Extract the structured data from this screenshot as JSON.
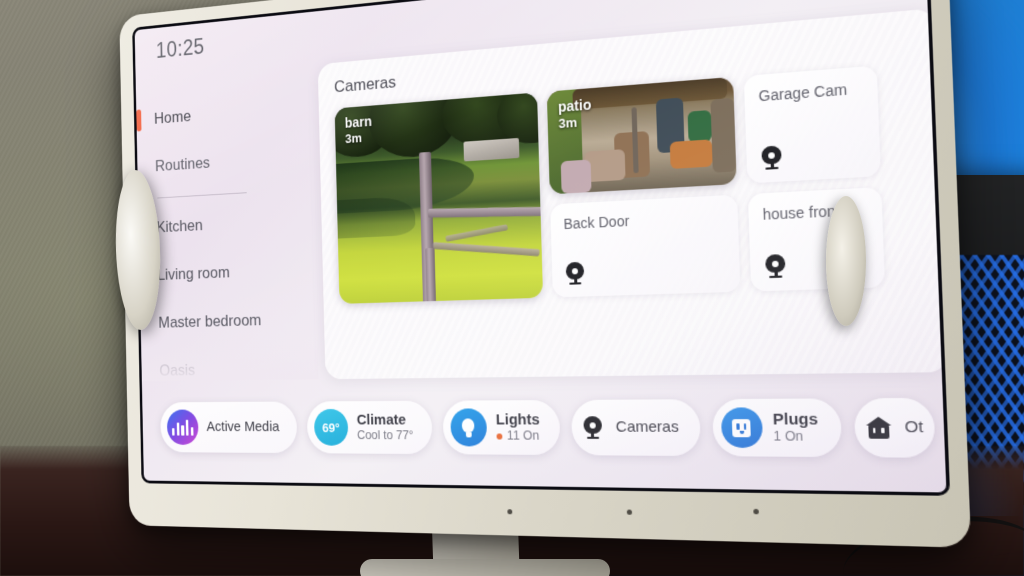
{
  "device": {
    "status_bar": {
      "time": "10:25"
    },
    "accent_color": "#f2512c"
  },
  "sidebar": {
    "items": [
      {
        "label": "Home",
        "active": true
      },
      {
        "label": "Routines",
        "active": false
      },
      {
        "label": "Kitchen",
        "active": false
      },
      {
        "label": "Living room",
        "active": false
      },
      {
        "label": "Master bedroom",
        "active": false
      },
      {
        "label": "Oasis",
        "active": false
      }
    ]
  },
  "cameras_panel": {
    "title": "Cameras",
    "cards": [
      {
        "name": "barn",
        "age": "3m",
        "live": true
      },
      {
        "name": "patio",
        "age": "3m",
        "live": true
      },
      {
        "name": "Garage Cam",
        "live": false,
        "icon": "camera-icon"
      },
      {
        "name": "Back Door",
        "live": false,
        "icon": "camera-icon"
      },
      {
        "name": "house front",
        "live": false,
        "icon": "camera-icon"
      }
    ]
  },
  "chip_bar": {
    "chips": [
      {
        "id": "active-media",
        "title": "Active Media",
        "sub": "",
        "icon": "equalizer-icon",
        "icon_color": "#7a3fe0"
      },
      {
        "id": "climate",
        "title": "Climate",
        "sub": "Cool to 77°",
        "badge": "69°",
        "icon": "temperature-badge",
        "icon_color": "#11a8d8"
      },
      {
        "id": "lights",
        "title": "Lights",
        "sub": "11 On",
        "dot_color": "#e8622a",
        "icon": "lightbulb-icon",
        "icon_color": "#1675d8"
      },
      {
        "id": "cameras",
        "title": "Cameras",
        "sub": "",
        "icon": "camera-icon"
      },
      {
        "id": "plugs",
        "title": "Plugs",
        "sub": "1 On",
        "icon": "outlet-icon",
        "icon_color": "#1a6bd4"
      },
      {
        "id": "other",
        "title": "Ot",
        "sub": "",
        "icon": "house-plug-icon"
      }
    ]
  }
}
